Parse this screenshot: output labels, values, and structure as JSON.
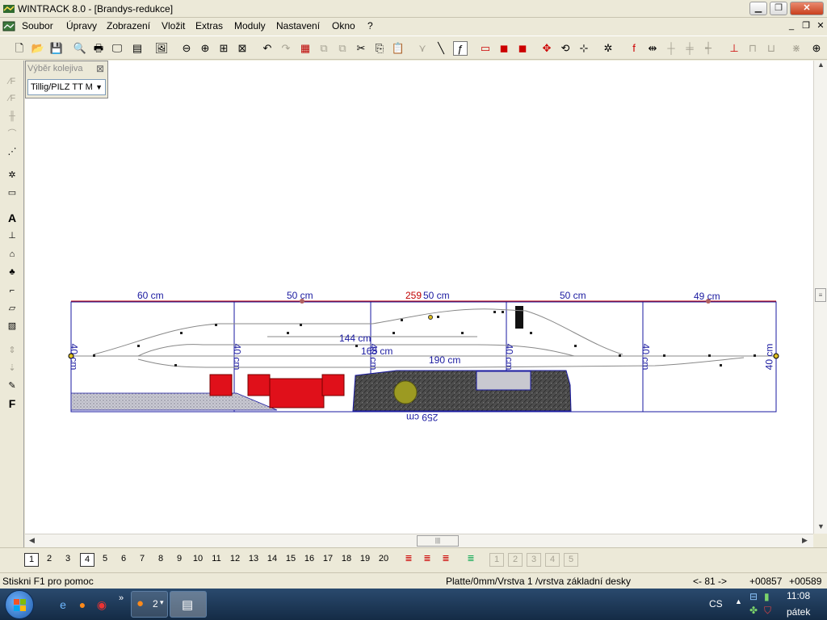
{
  "window": {
    "title": "WINTRACK 8.0 - [Brandys-redukce]"
  },
  "menu": [
    "Soubor",
    "Úpravy",
    "Zobrazení",
    "Vložit",
    "Extras",
    "Moduly",
    "Nastavení",
    "Okno",
    "?"
  ],
  "panel": {
    "title": "Výběr kolejiva",
    "selected": "Tillig/PILZ TT M"
  },
  "drawing": {
    "top_dims": [
      "60 cm",
      "50 cm",
      "50 cm",
      "50 cm",
      "49 cm"
    ],
    "total_top": "259",
    "side_dims": [
      "40 cm",
      "40 cm",
      "40 cm",
      "40 cm",
      "40 cm",
      "40 cm"
    ],
    "inner_dims": [
      "144 cm",
      "168 cm",
      "190 cm"
    ],
    "bottom_dim": "259 cm",
    "colors": {
      "frame": "#1a1aa0",
      "red_dim": "#c00000",
      "building": "#e0101a",
      "terrain": "#555555"
    }
  },
  "layers": [
    "1",
    "2",
    "3",
    "4",
    "5",
    "6",
    "7",
    "8",
    "9",
    "10",
    "11",
    "12",
    "13",
    "14",
    "15",
    "16",
    "17",
    "18",
    "19",
    "20"
  ],
  "layer_small": [
    "1",
    "2",
    "3",
    "4",
    "5"
  ],
  "status": {
    "help": "Stiskni F1 pro pomoc",
    "layer": "Platte/0mm/Vrstva 1 /vrstva základní desky",
    "angle": "<- 81 ->",
    "x": "+00857",
    "y": "+00589"
  },
  "taskbar": {
    "firefox_count": "2",
    "lang": "CS",
    "time": "11:08",
    "day": "pátek"
  }
}
